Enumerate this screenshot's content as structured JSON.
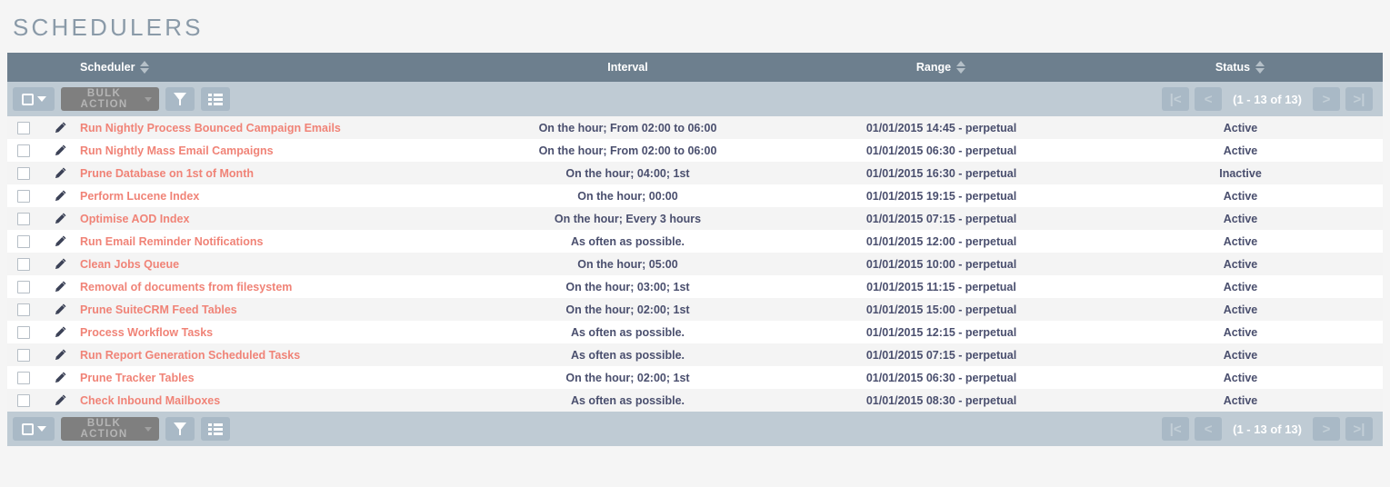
{
  "page": {
    "title": "SCHEDULERS",
    "accent_color": "#f08377",
    "header_bg": "#6d7f8e",
    "toolbar_bg": "#bfcbd4"
  },
  "columns": [
    {
      "key": "scheduler",
      "label": "Scheduler",
      "sortable": true
    },
    {
      "key": "interval",
      "label": "Interval",
      "sortable": false
    },
    {
      "key": "range",
      "label": "Range",
      "sortable": true
    },
    {
      "key": "status",
      "label": "Status",
      "sortable": true
    }
  ],
  "toolbar": {
    "select_all_label": "",
    "bulk_action_label": "BULK ACTION",
    "filter_icon": "funnel-icon",
    "column_chooser_icon": "list-icon",
    "checkbox_icon": "checkbox-icon",
    "caret_icon": "caret-down-icon"
  },
  "pagination": {
    "first_label": "|<",
    "prev_label": "<",
    "count_label": "(1 - 13 of 13)",
    "next_label": ">",
    "last_label": ">|"
  },
  "rows": [
    {
      "scheduler": "Run Nightly Process Bounced Campaign Emails",
      "interval": "On the hour; From 02:00 to 06:00",
      "range": "01/01/2015 14:45 - perpetual",
      "status": "Active"
    },
    {
      "scheduler": "Run Nightly Mass Email Campaigns",
      "interval": "On the hour; From 02:00 to 06:00",
      "range": "01/01/2015 06:30 - perpetual",
      "status": "Active"
    },
    {
      "scheduler": "Prune Database on 1st of Month",
      "interval": "On the hour; 04:00; 1st",
      "range": "01/01/2015 16:30 - perpetual",
      "status": "Inactive"
    },
    {
      "scheduler": "Perform Lucene Index",
      "interval": "On the hour; 00:00",
      "range": "01/01/2015 19:15 - perpetual",
      "status": "Active"
    },
    {
      "scheduler": "Optimise AOD Index",
      "interval": "On the hour; Every 3 hours",
      "range": "01/01/2015 07:15 - perpetual",
      "status": "Active"
    },
    {
      "scheduler": "Run Email Reminder Notifications",
      "interval": "As often as possible.",
      "range": "01/01/2015 12:00 - perpetual",
      "status": "Active"
    },
    {
      "scheduler": "Clean Jobs Queue",
      "interval": "On the hour; 05:00",
      "range": "01/01/2015 10:00 - perpetual",
      "status": "Active"
    },
    {
      "scheduler": "Removal of documents from filesystem",
      "interval": "On the hour; 03:00; 1st",
      "range": "01/01/2015 11:15 - perpetual",
      "status": "Active"
    },
    {
      "scheduler": "Prune SuiteCRM Feed Tables",
      "interval": "On the hour; 02:00; 1st",
      "range": "01/01/2015 15:00 - perpetual",
      "status": "Active"
    },
    {
      "scheduler": "Process Workflow Tasks",
      "interval": "As often as possible.",
      "range": "01/01/2015 12:15 - perpetual",
      "status": "Active"
    },
    {
      "scheduler": "Run Report Generation Scheduled Tasks",
      "interval": "As often as possible.",
      "range": "01/01/2015 07:15 - perpetual",
      "status": "Active"
    },
    {
      "scheduler": "Prune Tracker Tables",
      "interval": "On the hour; 02:00; 1st",
      "range": "01/01/2015 06:30 - perpetual",
      "status": "Active"
    },
    {
      "scheduler": "Check Inbound Mailboxes",
      "interval": "As often as possible.",
      "range": "01/01/2015 08:30 - perpetual",
      "status": "Active"
    }
  ]
}
